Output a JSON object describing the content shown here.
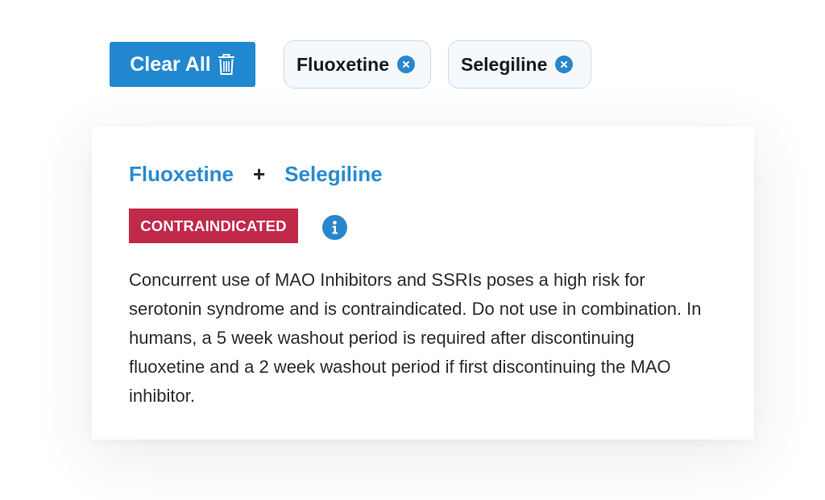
{
  "toolbar": {
    "clear_label": "Clear All",
    "clear_icon": "trash-icon",
    "chips": [
      {
        "label": "Fluoxetine",
        "remove_icon": "close-circle-icon"
      },
      {
        "label": "Selegiline",
        "remove_icon": "close-circle-icon"
      }
    ]
  },
  "interaction": {
    "drug_a": "Fluoxetine",
    "plus": "+",
    "drug_b": "Selegiline",
    "severity": "CONTRAINDICATED",
    "info_icon": "info-icon",
    "description": "Concurrent use of MAO Inhibitors and SSRIs poses a high risk for serotonin syndrome and is contraindicated. Do not use in combination. In humans, a 5 week washout period is required after discontinuing fluoxetine and a 2 week washout period if first discontinuing the MAO inhibitor."
  },
  "colors": {
    "primary": "#2188cf",
    "link": "#2a8ad0",
    "severity": "#c1294a",
    "chip_bg": "#f5f9fc",
    "chip_border": "#ccdce9",
    "text": "#2b2b2b"
  }
}
